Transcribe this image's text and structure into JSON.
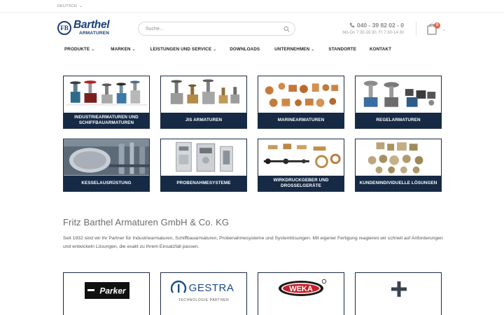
{
  "header": {
    "language": "DEUTSCH",
    "logo": {
      "name": "Barthel",
      "sub": "ARMATUREN",
      "mark": "FB"
    },
    "search": {
      "placeholder": "Suche..."
    },
    "phone": "040 - 39 82 02 - 0",
    "hours": "Mo-Do 7:30-16:30, Fr 7:30-14:30",
    "cart_count": "0"
  },
  "nav": [
    {
      "label": "PRODUKTE",
      "dropdown": true
    },
    {
      "label": "MARKEN",
      "dropdown": true
    },
    {
      "label": "LEISTUNGEN UND SERVICE",
      "dropdown": true
    },
    {
      "label": "DOWNLOADS",
      "dropdown": false
    },
    {
      "label": "UNTERNEHMEN",
      "dropdown": true
    },
    {
      "label": "STANDORTE",
      "dropdown": false
    },
    {
      "label": "KONTAKT",
      "dropdown": false
    }
  ],
  "categories": [
    {
      "label": "INDUSTRIEARMATUREN UND SCHIFFBAUARMATUREN"
    },
    {
      "label": "JIS ARMATUREN"
    },
    {
      "label": "MARINEARMATUREN"
    },
    {
      "label": "REGELARMATUREN"
    },
    {
      "label": "KESSELAUSRÜSTUNG"
    },
    {
      "label": "PROBENAHMESYSTEME"
    },
    {
      "label": "WIRKDRUCKGEBER UND DROSSELGERÄTE"
    },
    {
      "label": "KUNDENINDIVIDUELLE LÖSUNGEN"
    }
  ],
  "intro": {
    "title": "Fritz Barthel Armaturen GmbH & Co. KG",
    "text": "Seit 1932 sind wir Ihr Partner für Industriearmaturen, Schiffbauarmaturen, Probenahmesysteme und Systemlösungen. Mit eigener Fertigung reagieren wir schnell auf Anforderungen und entwickeln Lösungen, die exakt zu Ihrem Einsatzfall passen."
  },
  "partners": {
    "parker": "Parker",
    "gestra": "GESTRA",
    "gestra_sub": "TECHNOLOGIE PARTNER",
    "weka": "WEKA",
    "more": "+"
  },
  "colors": {
    "brand_blue": "#1b3f7a",
    "tile_label_bg": "#162a45",
    "cart_badge": "#e06a4e"
  }
}
